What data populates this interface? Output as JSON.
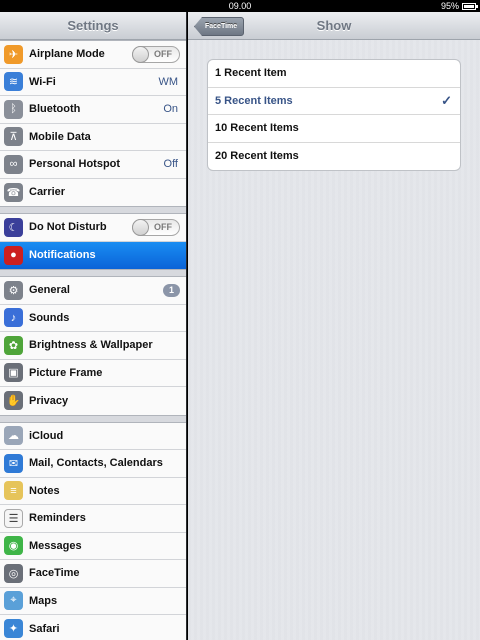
{
  "status_bar": {
    "time": "09.00",
    "battery": "95%"
  },
  "master": {
    "title": "Settings",
    "groups": [
      [
        {
          "label": "Airplane Mode",
          "icon": "airplane-icon",
          "toggle": "OFF"
        },
        {
          "label": "Wi-Fi",
          "icon": "wifi-icon",
          "value": "WM"
        },
        {
          "label": "Bluetooth",
          "icon": "bluetooth-icon",
          "value": "On"
        },
        {
          "label": "Mobile Data",
          "icon": "antenna-icon"
        },
        {
          "label": "Personal Hotspot",
          "icon": "hotspot-icon",
          "value": "Off"
        },
        {
          "label": "Carrier",
          "icon": "phone-icon"
        }
      ],
      [
        {
          "label": "Do Not Disturb",
          "icon": "moon-icon",
          "toggle": "OFF"
        },
        {
          "label": "Notifications",
          "icon": "notifications-icon",
          "selected": true
        }
      ],
      [
        {
          "label": "General",
          "icon": "gear-icon",
          "badge": "1"
        },
        {
          "label": "Sounds",
          "icon": "speaker-icon"
        },
        {
          "label": "Brightness & Wallpaper",
          "icon": "flower-icon"
        },
        {
          "label": "Picture Frame",
          "icon": "picture-frame-icon"
        },
        {
          "label": "Privacy",
          "icon": "hand-icon"
        }
      ],
      [
        {
          "label": "iCloud",
          "icon": "cloud-icon"
        },
        {
          "label": "Mail, Contacts, Calendars",
          "icon": "mail-icon"
        },
        {
          "label": "Notes",
          "icon": "notes-icon"
        },
        {
          "label": "Reminders",
          "icon": "reminders-icon"
        },
        {
          "label": "Messages",
          "icon": "messages-icon"
        },
        {
          "label": "FaceTime",
          "icon": "facetime-icon"
        },
        {
          "label": "Maps",
          "icon": "maps-icon"
        },
        {
          "label": "Safari",
          "icon": "compass-icon"
        }
      ]
    ]
  },
  "detail": {
    "back_label": "FaceTime",
    "title": "Show",
    "options": [
      {
        "label": "1 Recent Item",
        "checked": false
      },
      {
        "label": "5 Recent Items",
        "checked": true
      },
      {
        "label": "10 Recent Items",
        "checked": false
      },
      {
        "label": "20 Recent Items",
        "checked": false
      }
    ],
    "check_glyph": "✓"
  },
  "icon_colors": {
    "airplane-icon": "#f09a2a",
    "wifi-icon": "#3a7fd8",
    "bluetooth-icon": "#8a8f99",
    "antenna-icon": "#7d828b",
    "hotspot-icon": "#7d828b",
    "phone-icon": "#7d828b",
    "moon-icon": "#3b3f9a",
    "notifications-icon": "#cc1f1f",
    "gear-icon": "#7d828b",
    "speaker-icon": "#3a6fd8",
    "flower-icon": "#4fa53a",
    "picture-frame-icon": "#6a6f78",
    "hand-icon": "#6a6f78",
    "cloud-icon": "#9aa6b8",
    "mail-icon": "#2f7ad6",
    "notes-icon": "#e6c45a",
    "reminders-icon": "#f5f5f5",
    "messages-icon": "#3fb548",
    "facetime-icon": "#6a6f78",
    "maps-icon": "#5aa0d8",
    "compass-icon": "#3a86d6"
  },
  "icon_glyphs": {
    "airplane-icon": "✈",
    "wifi-icon": "≋",
    "bluetooth-icon": "ᛒ",
    "antenna-icon": "⊼",
    "hotspot-icon": "∞",
    "phone-icon": "☎",
    "moon-icon": "☾",
    "notifications-icon": "●",
    "gear-icon": "⚙",
    "speaker-icon": "♪",
    "flower-icon": "✿",
    "picture-frame-icon": "▣",
    "hand-icon": "✋",
    "cloud-icon": "☁",
    "mail-icon": "✉",
    "notes-icon": "≡",
    "reminders-icon": "☰",
    "messages-icon": "◉",
    "facetime-icon": "◎",
    "maps-icon": "⌖",
    "compass-icon": "✦"
  }
}
